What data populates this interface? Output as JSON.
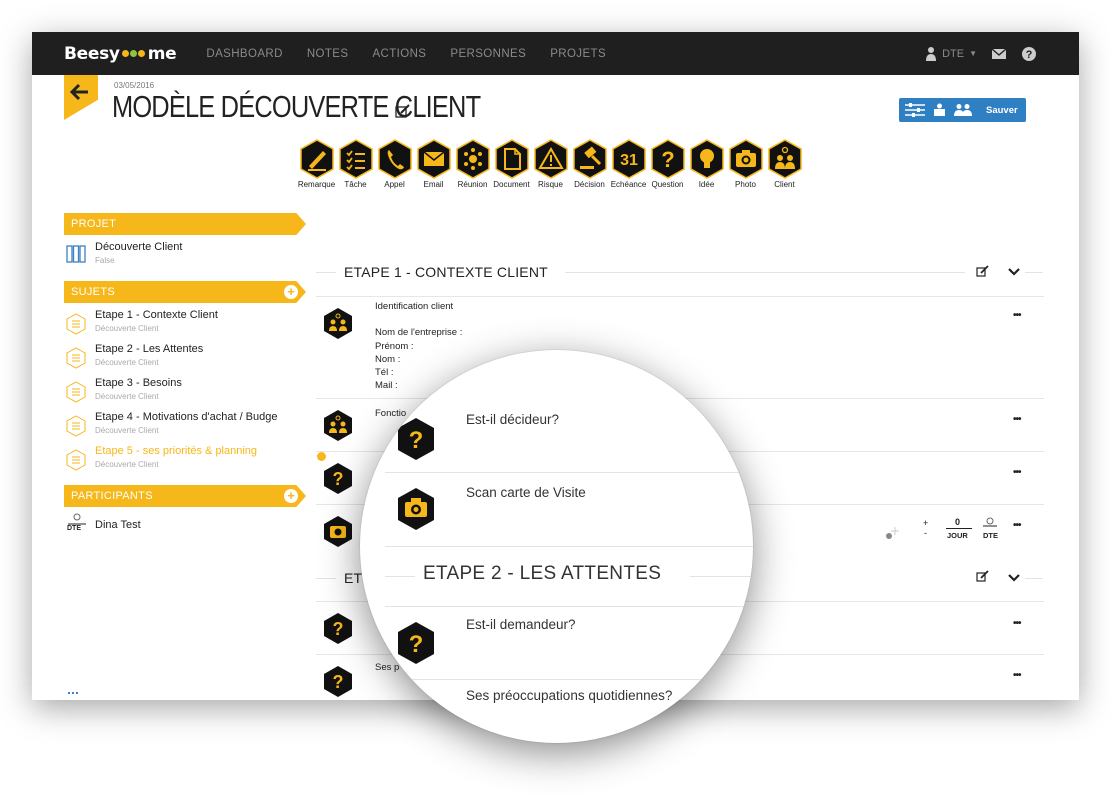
{
  "nav": {
    "logo_left": "Beesy",
    "logo_right": "me",
    "links": [
      "DASHBOARD",
      "NOTES",
      "ACTIONS",
      "PERSONNES",
      "PROJETS"
    ],
    "user": "DTE"
  },
  "header": {
    "date": "03/05/2016",
    "title": "MODÈLE DÉCOUVERTE CLIENT",
    "save_label": "Sauver"
  },
  "toolbar_icons": [
    {
      "label": "Remarque",
      "icon": "pen-icon"
    },
    {
      "label": "Tâche",
      "icon": "checklist-icon"
    },
    {
      "label": "Appel",
      "icon": "phone-icon"
    },
    {
      "label": "Email",
      "icon": "mail-icon"
    },
    {
      "label": "Réunion",
      "icon": "meeting-icon"
    },
    {
      "label": "Document",
      "icon": "document-icon"
    },
    {
      "label": "Risque",
      "icon": "warning-icon"
    },
    {
      "label": "Décision",
      "icon": "gavel-icon"
    },
    {
      "label": "Echéance",
      "icon": "calendar-icon"
    },
    {
      "label": "Question",
      "icon": "question-icon"
    },
    {
      "label": "Idée",
      "icon": "lightbulb-icon"
    },
    {
      "label": "Photo",
      "icon": "camera-icon"
    },
    {
      "label": "Client",
      "icon": "client-icon"
    }
  ],
  "sidebar": {
    "projet_header": "PROJET",
    "projet": {
      "title": "Découverte Client",
      "sub": "False"
    },
    "sujets_header": "SUJETS",
    "sujets": [
      {
        "title": "Etape 1 - Contexte Client",
        "sub": "Découverte Client"
      },
      {
        "title": "Etape 2 - Les Attentes",
        "sub": "Découverte Client"
      },
      {
        "title": "Etape 3 - Besoins",
        "sub": "Découverte Client"
      },
      {
        "title": "Etape 4 - Motivations d'achat / Budge",
        "sub": "Découverte Client"
      },
      {
        "title": "Etape 5 - ses priorités & planning",
        "sub": "Découverte Client"
      }
    ],
    "participants_header": "PARTICIPANTS",
    "participants": [
      {
        "initials": "DTE",
        "name": "Dina Test"
      }
    ]
  },
  "main": {
    "etape1_title": "ETAPE 1 - CONTEXTE CLIENT",
    "row1_lines": [
      "Identification client",
      "",
      "Nom de l'entreprise :",
      "Prénom :",
      "Nom :",
      "Tél :",
      "Mail :"
    ],
    "row2_text": "Fonctio",
    "photo_row": {
      "plus": "+",
      "minus": "-",
      "value": "0",
      "unit": "JOUR",
      "initials": "DTE"
    },
    "etape2_partial": "ET",
    "row_partial": "Ses p"
  },
  "magnifier": {
    "q1": "Est-il décideur?",
    "q2": "Scan carte de Visite",
    "etape2_title": "ETAPE 2 - LES ATTENTES",
    "q3": "Est-il demandeur?",
    "q4": "Ses préoccupations quotidiennes?"
  },
  "colors": {
    "accent": "#f6b71a",
    "nav_bg": "#1f1f1f",
    "save_blue": "#2f7fc3"
  }
}
